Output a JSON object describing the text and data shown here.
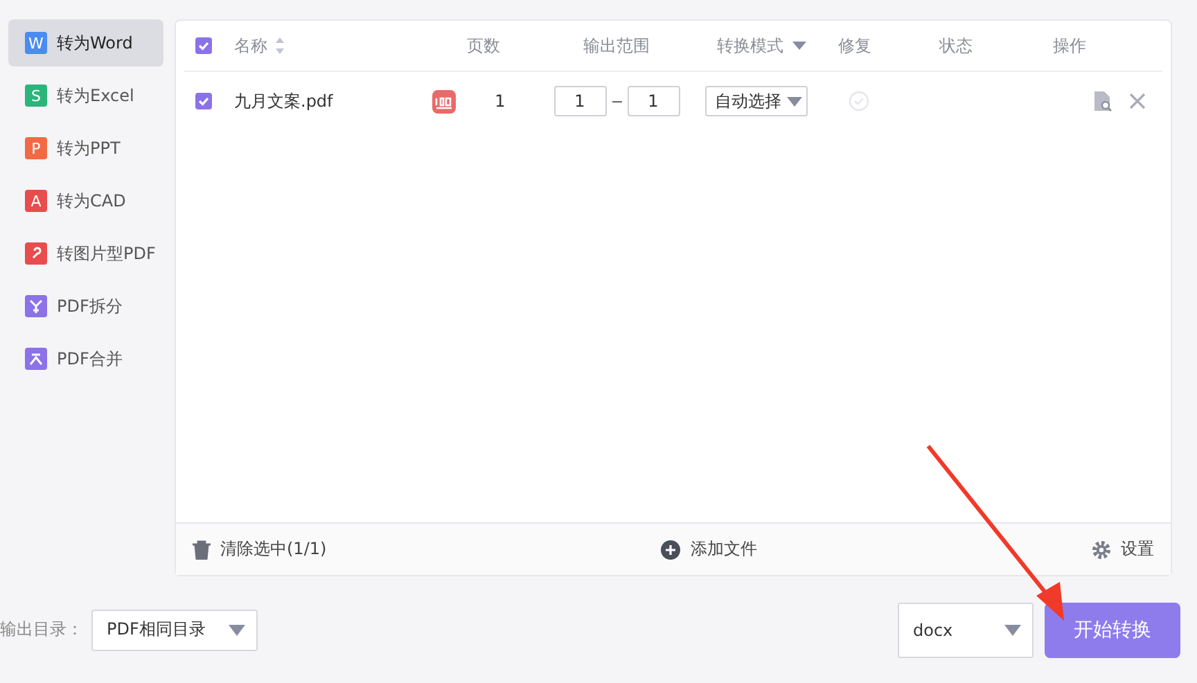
{
  "sidebar": {
    "items": [
      {
        "label": "转为Word",
        "selected": true,
        "kind": "letter",
        "glyph": "W",
        "color": "#4a8cf0"
      },
      {
        "label": "转为Excel",
        "selected": false,
        "kind": "letter",
        "glyph": "S",
        "color": "#2bb57a"
      },
      {
        "label": "转为PPT",
        "selected": false,
        "kind": "letter",
        "glyph": "P",
        "color": "#f26a45"
      },
      {
        "label": "转为CAD",
        "selected": false,
        "kind": "letter",
        "glyph": "A",
        "color": "#e84c4c"
      },
      {
        "label": "转图片型PDF",
        "selected": false,
        "kind": "image",
        "color": "#e84c4c"
      },
      {
        "label": "PDF拆分",
        "selected": false,
        "kind": "split",
        "color": "#8b72e8"
      },
      {
        "label": "PDF合并",
        "selected": false,
        "kind": "merge",
        "color": "#8b72e8"
      }
    ]
  },
  "table": {
    "select_all": true,
    "columns": [
      {
        "label": "名称",
        "kind": "sort"
      },
      {
        "label": "页数",
        "kind": "plain"
      },
      {
        "label": "输出范围",
        "kind": "plain"
      },
      {
        "label": "转换模式",
        "kind": "dropdown"
      },
      {
        "label": "修复",
        "kind": "plain"
      },
      {
        "label": "状态",
        "kind": "plain"
      },
      {
        "label": "操作",
        "kind": "plain"
      }
    ],
    "rows": [
      {
        "checked": true,
        "name": "九月文案.pdf",
        "pages": "1",
        "range_from": "1",
        "range_to": "1",
        "mode": "自动选择"
      }
    ]
  },
  "footer": {
    "clear": "清除选中(1/1)",
    "add": "添加文件",
    "settings": "设置"
  },
  "bottom": {
    "output_label": "输出目录：",
    "output_dir": "PDF相同目录",
    "format": "docx",
    "start": "开始转换"
  }
}
